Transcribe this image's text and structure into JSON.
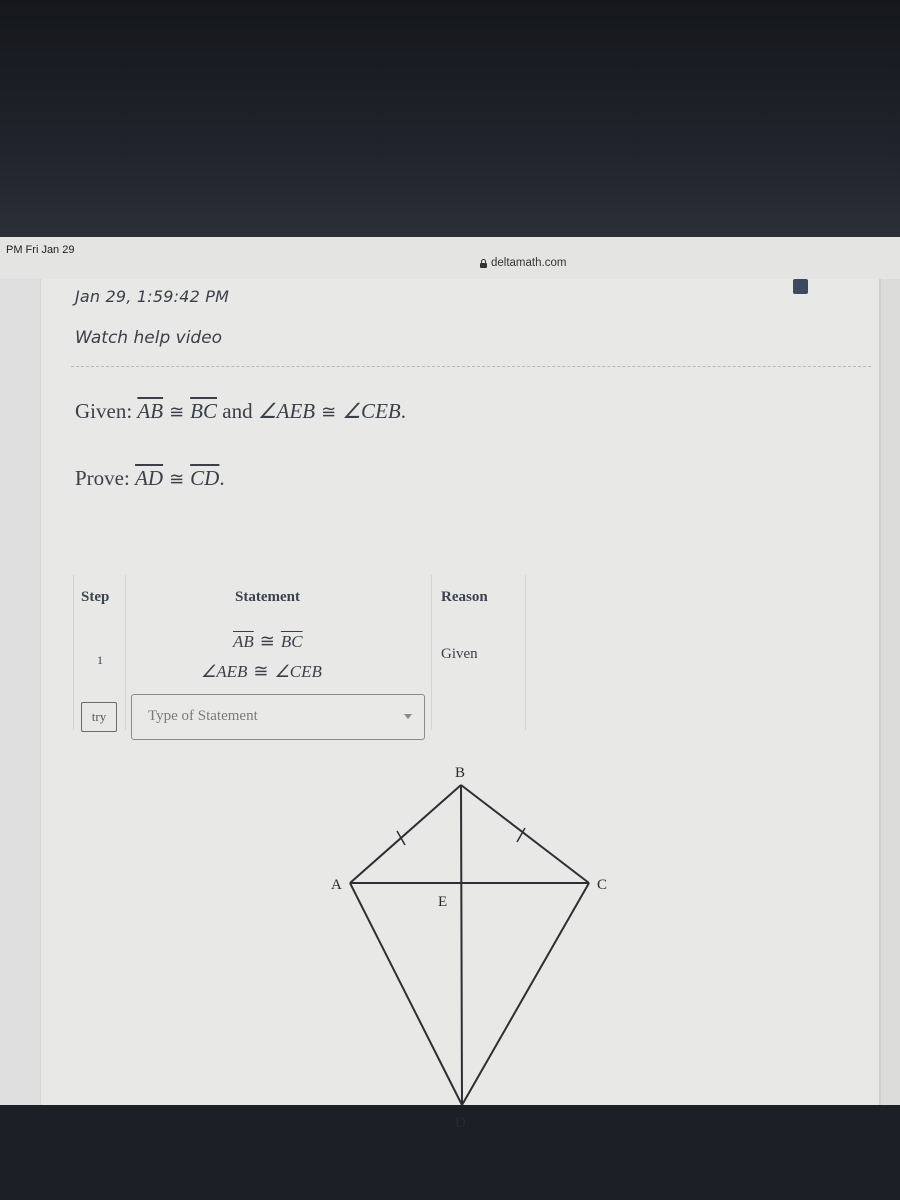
{
  "status_bar": {
    "time": "PM  Fri Jan 29"
  },
  "browser": {
    "url": "deltamath.com",
    "lock_icon": "lock-icon"
  },
  "page": {
    "timestamp": "Jan 29, 1:59:42 PM",
    "help_link": "Watch help video",
    "given": {
      "label": "Given:",
      "seg1": "AB",
      "seg2": "BC",
      "and": "and",
      "angle1": "∠AEB",
      "angle2": "∠CEB",
      "period": "."
    },
    "prove": {
      "label": "Prove:",
      "seg1": "AD",
      "seg2": "CD",
      "period": "."
    },
    "congruent_symbol": "≅",
    "table": {
      "headers": {
        "step": "Step",
        "statement": "Statement",
        "reason": "Reason"
      },
      "rows": [
        {
          "step": "1",
          "statement_line1": {
            "seg1": "AB",
            "seg2": "BC"
          },
          "statement_line2": {
            "angle1": "∠AEB",
            "angle2": "∠CEB"
          },
          "reason": "Given"
        }
      ],
      "try_label": "try",
      "type_select": {
        "placeholder": "Type of Statement",
        "icon": "chevron-down-icon"
      }
    },
    "diagram": {
      "points": {
        "A": "A",
        "B": "B",
        "C": "C",
        "D": "D",
        "E": "E"
      },
      "tick_marks": [
        "AB",
        "BC"
      ]
    }
  }
}
